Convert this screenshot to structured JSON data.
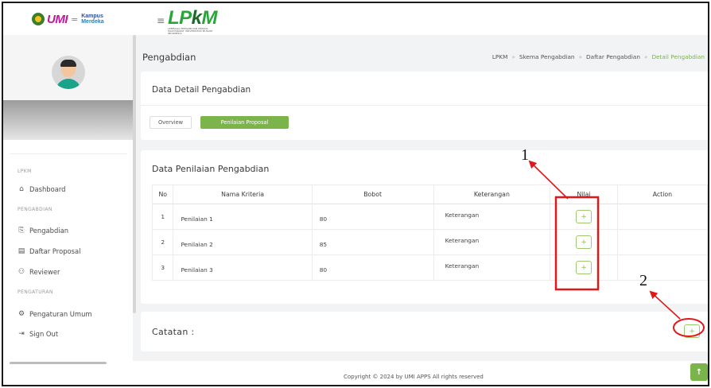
{
  "sidebar": {
    "logo": {
      "umi": "UMI",
      "kampus": "Kampus",
      "merdeka": "Merdeka"
    },
    "sections": {
      "lpkm": "LPKM",
      "pengabdian": "PENGABDIAN",
      "pengaturan": "PENGATURAN"
    },
    "items": {
      "dashboard": "Dashboard",
      "pengabdian": "Pengabdian",
      "daftar_proposal": "Daftar Proposal",
      "reviewer": "Reviewer",
      "pengaturan_umum": "Pengaturan Umum",
      "sign_out": "Sign Out"
    }
  },
  "topbar": {
    "logo_main": "LP",
    "logo_k": "k",
    "logo_m": "M",
    "logo_sub": "LEMBAGA PENGABDIAN KEPADA MASYARAKAT UNIVERSITAS MUSLIM INDONESIA"
  },
  "header": {
    "title": "Pengabdian",
    "breadcrumb": [
      "LPKM",
      "Skema Pengabdian",
      "Daftar Pengabdian",
      "Detail Pengabdian"
    ]
  },
  "detail_card": {
    "title": "Data Detail Pengabdian",
    "tabs": [
      "Overview",
      "Penilaian Proposal"
    ],
    "active_tab": "Penilaian Proposal"
  },
  "penilaian_card": {
    "title": "Data Penilaian Pengabdian",
    "columns": [
      "No",
      "Nama Kriteria",
      "Bobot",
      "Keterangan",
      "Nilai",
      "Action"
    ],
    "rows": [
      {
        "no": "1",
        "nama": "Penilaian 1",
        "bobot": "80",
        "keterangan": "Keterangan",
        "nilai_btn": "+"
      },
      {
        "no": "2",
        "nama": "Penilaian 2",
        "bobot": "85",
        "keterangan": "Keterangan",
        "nilai_btn": "+"
      },
      {
        "no": "3",
        "nama": "Penilaian 3",
        "bobot": "80",
        "keterangan": "Keterangan",
        "nilai_btn": "+"
      }
    ]
  },
  "catatan_card": {
    "label": "Catatan :",
    "add_btn": "+"
  },
  "footer": {
    "copyright": "Copyright © 2024 by UMI APPS All rights reserved",
    "scroll_top": "↑"
  },
  "annotations": {
    "label_1": "1",
    "label_2": "2"
  },
  "colors": {
    "accent": "#7bb44b",
    "annotation": "#e01818"
  },
  "icons": [
    "hamburger-icon",
    "home-icon",
    "clipboard-icon",
    "document-icon",
    "user-icon",
    "settings-icon",
    "sign-out-icon",
    "plus-icon",
    "arrow-up-icon"
  ]
}
